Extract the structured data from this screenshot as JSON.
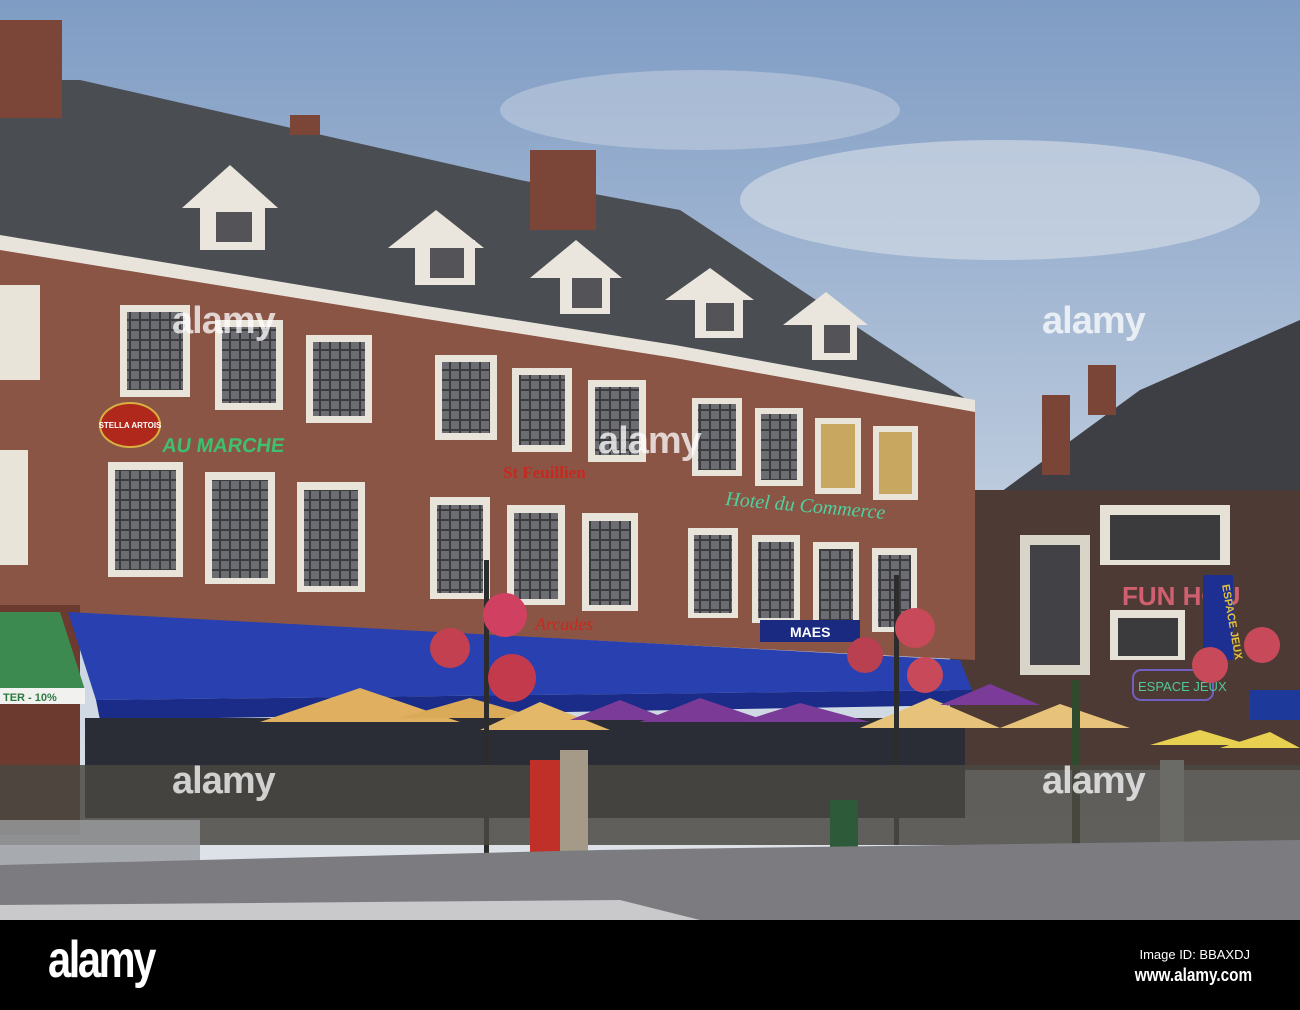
{
  "photo": {
    "signs": {
      "stella": "STELLA ARTOIS",
      "au_marche": "AU MARCHE",
      "st_feuillien": "St Feuillien",
      "hotel": "Hotel du Commerce",
      "arcades": "Arcades",
      "maes": "MAES",
      "fun_house": "FUN HOU",
      "espace_jeux": "ESPACE JEUX",
      "banner": "ESPACE JEUX",
      "discount": "TER - 10%"
    },
    "watermark": "alamy"
  },
  "footer": {
    "logo": "alamy",
    "image_id": "Image ID: BBAXDJ",
    "url": "www.alamy.com"
  },
  "colors": {
    "sky": "#9fb6d4",
    "awning": "#1f3aa8",
    "brick": "#8a5544",
    "roof": "#4a4d52"
  }
}
